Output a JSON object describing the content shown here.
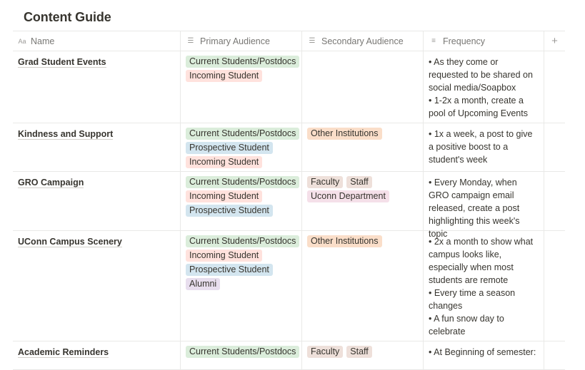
{
  "page": {
    "title": "Content Guide"
  },
  "columns": {
    "name": {
      "label": "Name",
      "icon": "text-property-icon"
    },
    "primary": {
      "label": "Primary Audience",
      "icon": "multi-select-icon"
    },
    "secondary": {
      "label": "Secondary Audience",
      "icon": "multi-select-icon"
    },
    "frequency": {
      "label": "Frequency",
      "icon": "text-lines-icon"
    },
    "add": {
      "label": "+",
      "icon": "plus-icon"
    }
  },
  "rows": [
    {
      "name": "Grad Student Events",
      "primary": [
        {
          "label": "Current Students/Postdocs",
          "color": "green"
        },
        {
          "label": "Incoming Student",
          "color": "red"
        }
      ],
      "secondary": [],
      "frequency": [
        "• As they come or requested to be shared on social media/Soapbox",
        "• 1-2x a month, create a pool of Upcoming Events"
      ]
    },
    {
      "name": "Kindness and Support",
      "primary": [
        {
          "label": "Current Students/Postdocs",
          "color": "green"
        },
        {
          "label": "Prospective Student",
          "color": "blue"
        },
        {
          "label": "Incoming Student",
          "color": "red"
        }
      ],
      "secondary": [
        {
          "label": "Other Institutions",
          "color": "orange"
        }
      ],
      "frequency": [
        "• 1x a week, a post to give a positive boost to a student's week"
      ]
    },
    {
      "name": "GRO Campaign",
      "primary": [
        {
          "label": "Current Students/Postdocs",
          "color": "green"
        },
        {
          "label": "Incoming Student",
          "color": "red"
        },
        {
          "label": "Prospective Student",
          "color": "blue"
        }
      ],
      "secondary": [
        {
          "label": "Faculty",
          "color": "brown"
        },
        {
          "label": "Staff",
          "color": "brown"
        },
        {
          "label": "Uconn Department",
          "color": "pink"
        }
      ],
      "frequency": [
        "• Every Monday, when GRO campaign email released, create a post highlighting this week's topic"
      ]
    },
    {
      "name": "UConn Campus Scenery",
      "primary": [
        {
          "label": "Current Students/Postdocs",
          "color": "green"
        },
        {
          "label": "Incoming Student",
          "color": "red"
        },
        {
          "label": "Prospective Student",
          "color": "blue"
        },
        {
          "label": "Alumni",
          "color": "purple"
        }
      ],
      "secondary": [
        {
          "label": "Other Institutions",
          "color": "orange"
        }
      ],
      "frequency": [
        "• 2x a month to show what campus looks like, especially when most students are remote",
        "• Every time a season changes",
        "• A fun snow day to celebrate"
      ]
    },
    {
      "name": "Academic Reminders",
      "primary": [
        {
          "label": "Current Students/Postdocs",
          "color": "green"
        }
      ],
      "secondary": [
        {
          "label": "Faculty",
          "color": "brown"
        },
        {
          "label": "Staff",
          "color": "brown"
        }
      ],
      "frequency": [
        "• At Beginning of semester:"
      ]
    }
  ]
}
